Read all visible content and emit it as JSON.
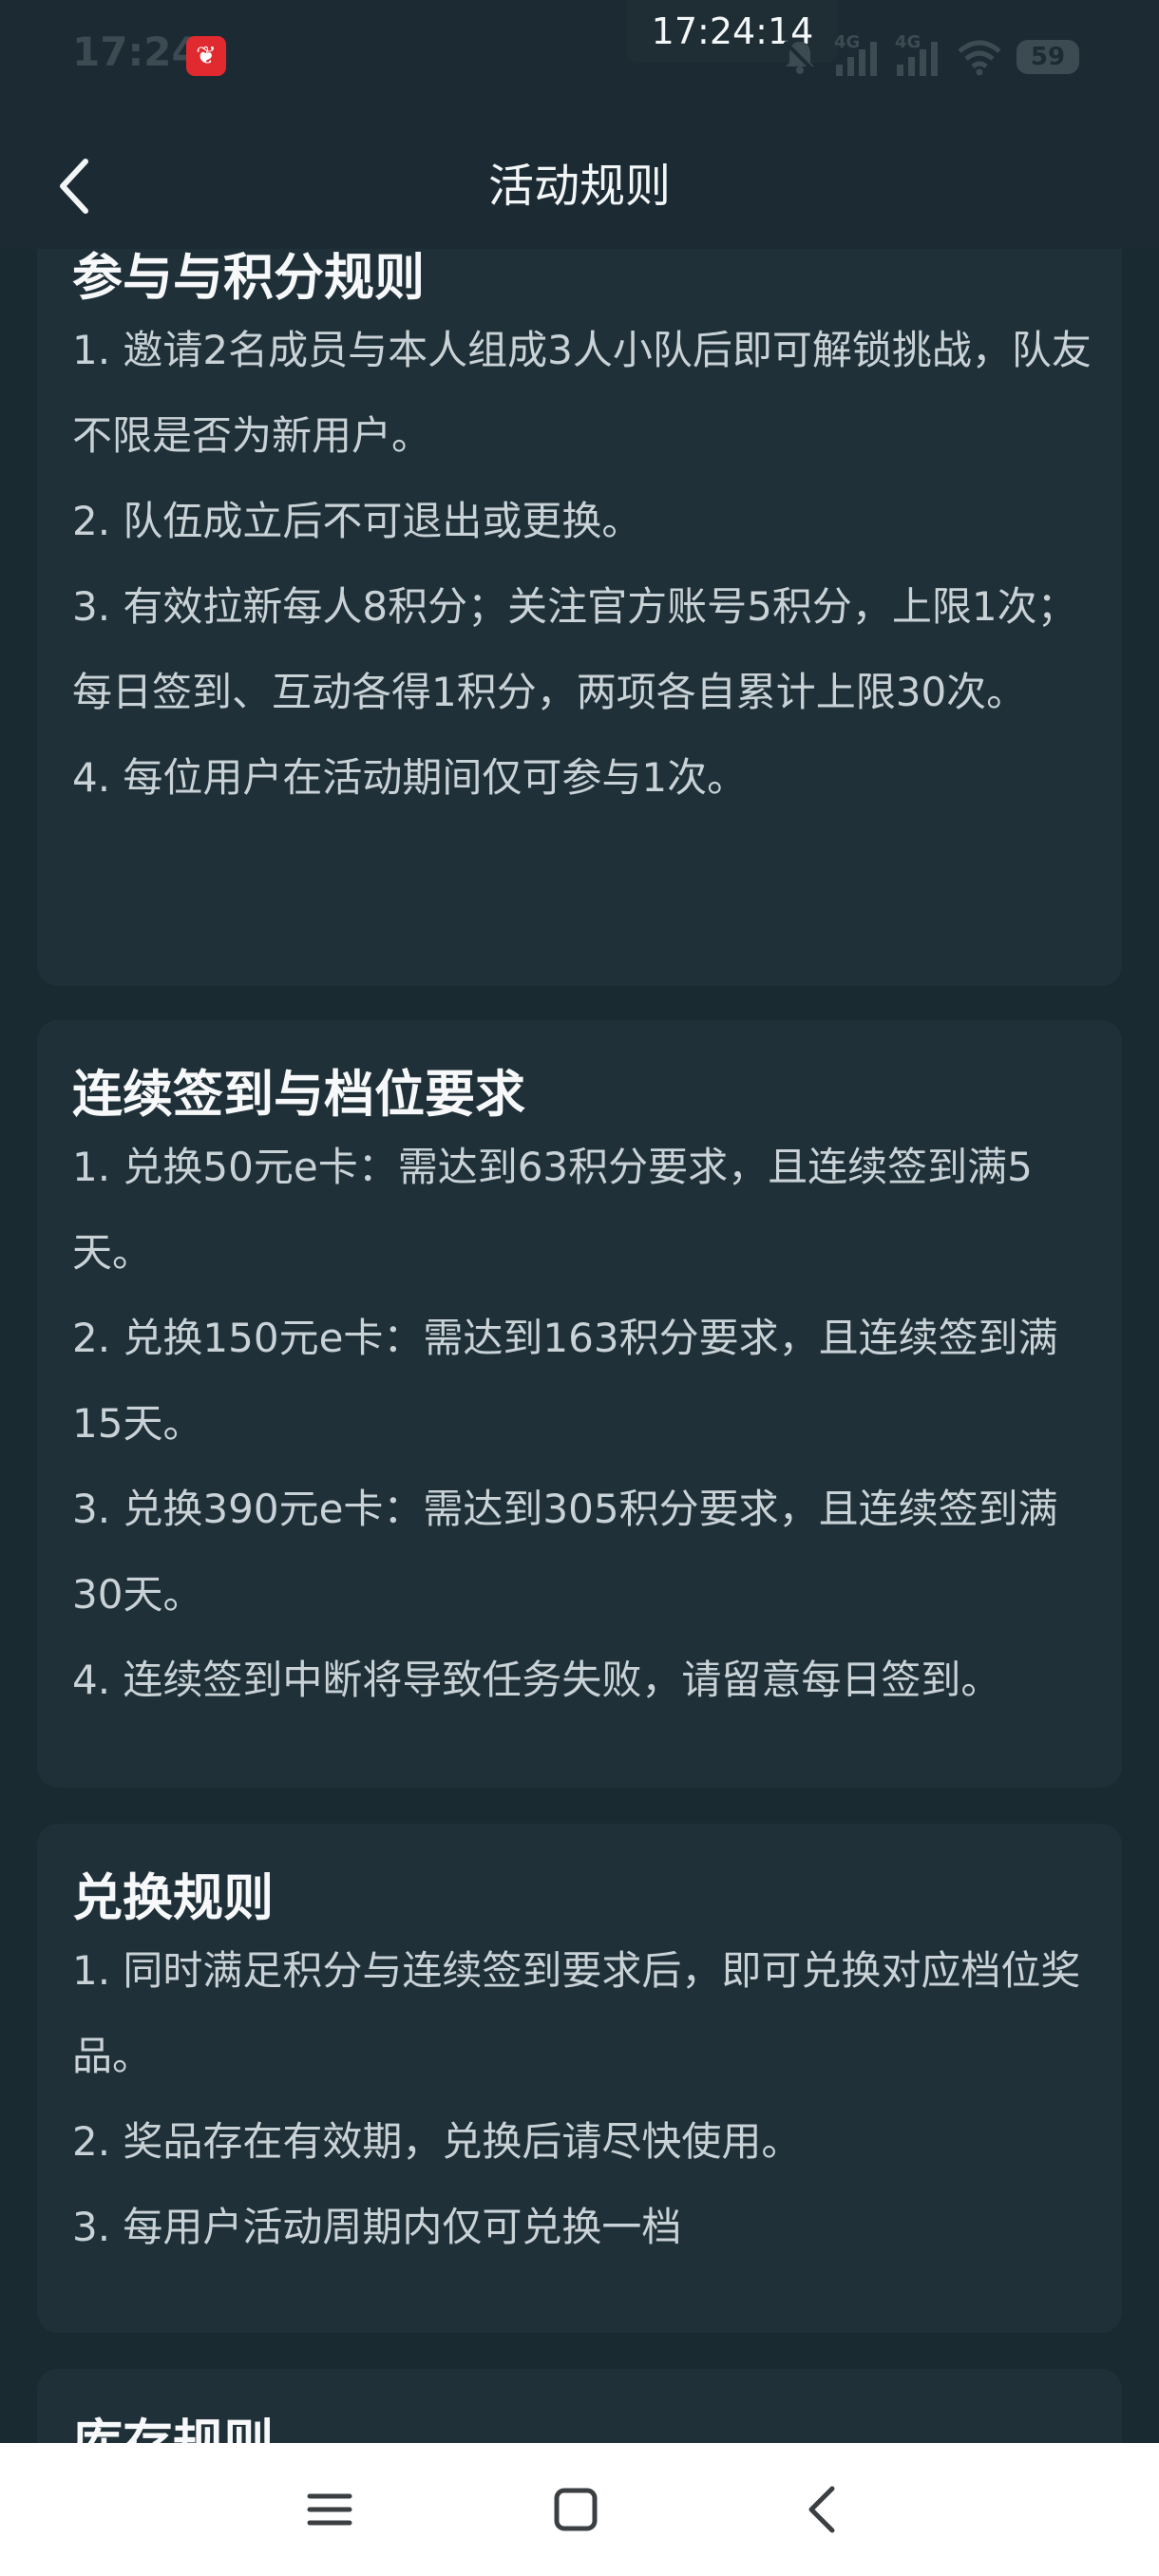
{
  "status_bar": {
    "time": "17:24",
    "clock_overlay": "17:24:14",
    "network_1": "4G",
    "network_2": "4G",
    "battery": "59",
    "app_icon": "red-app-icon"
  },
  "header": {
    "title": "活动规则",
    "back_icon": "chevron-left-icon"
  },
  "sections": [
    {
      "title": "参与与积分规则",
      "items": [
        "1. 邀请2名成员与本人组成3人小队后即可解锁挑战，队友不限是否为新用户。",
        "2. 队伍成立后不可退出或更换。",
        "3. 有效拉新每人8积分；关注官方账号5积分，上限1次；每日签到、互动各得1积分，两项各自累计上限30次。",
        "4. 每位用户在活动期间仅可参与1次。"
      ]
    },
    {
      "title": "连续签到与档位要求",
      "items": [
        "1. 兑换50元e卡：需达到63积分要求，且连续签到满5天。",
        "2. 兑换150元e卡：需达到163积分要求，且连续签到满15天。",
        "3. 兑换390元e卡：需达到305积分要求，且连续签到满30天。",
        "4. 连续签到中断将导致任务失败，请留意每日签到。"
      ]
    },
    {
      "title": "兑换规则",
      "items": [
        "1. 同时满足积分与连续签到要求后，即可兑换对应档位奖品。",
        "2. 奖品存在有效期，兑换后请尽快使用。",
        "3. 每用户活动周期内仅可兑换一档"
      ]
    },
    {
      "title": "库存规则",
      "items": []
    }
  ],
  "nav_bar": {
    "menu_icon": "menu-icon",
    "home_icon": "home-square-icon",
    "back_icon": "back-triangle-icon"
  }
}
